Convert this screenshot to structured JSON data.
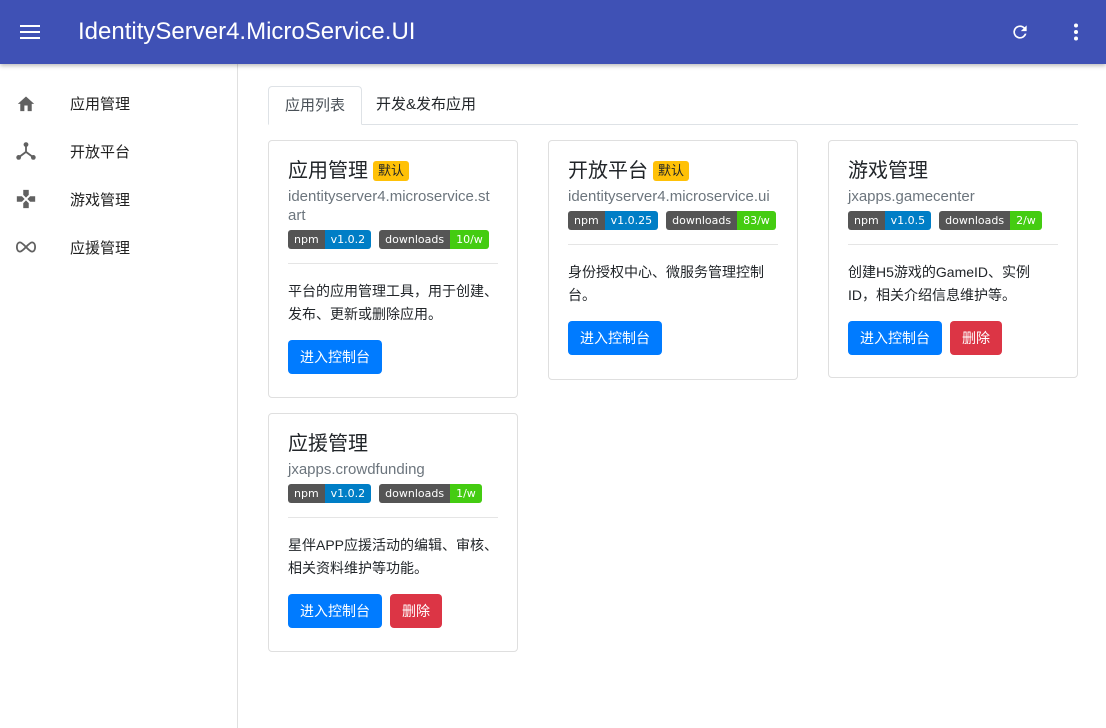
{
  "appbar": {
    "title": "IdentityServer4.MicroService.UI"
  },
  "sidebar": {
    "items": [
      {
        "label": "应用管理",
        "icon": "home-icon"
      },
      {
        "label": "开放平台",
        "icon": "hub-icon"
      },
      {
        "label": "游戏管理",
        "icon": "gamepad-icon"
      },
      {
        "label": "应援管理",
        "icon": "infinity-icon"
      }
    ]
  },
  "tabs": [
    {
      "label": "应用列表",
      "active": true
    },
    {
      "label": "开发&发布应用",
      "active": false
    }
  ],
  "cards": [
    {
      "title": "应用管理",
      "badge": "默认",
      "package": "identityserver4.microservice.start",
      "npm_label": "npm",
      "npm_version": "v1.0.2",
      "downloads_label": "downloads",
      "downloads_value": "10/w",
      "description": "平台的应用管理工具，用于创建、发布、更新或删除应用。",
      "console_button": "进入控制台"
    },
    {
      "title": "开放平台",
      "badge": "默认",
      "package": "identityserver4.microservice.ui",
      "npm_label": "npm",
      "npm_version": "v1.0.25",
      "downloads_label": "downloads",
      "downloads_value": "83/w",
      "description": "身份授权中心、微服务管理控制台。",
      "console_button": "进入控制台"
    },
    {
      "title": "游戏管理",
      "package": "jxapps.gamecenter",
      "npm_label": "npm",
      "npm_version": "v1.0.5",
      "downloads_label": "downloads",
      "downloads_value": "2/w",
      "description": "创建H5游戏的GameID、实例ID，相关介绍信息维护等。",
      "console_button": "进入控制台",
      "delete_button": "删除"
    },
    {
      "title": "应援管理",
      "package": "jxapps.crowdfunding",
      "npm_label": "npm",
      "npm_version": "v1.0.2",
      "downloads_label": "downloads",
      "downloads_value": "1/w",
      "description": "星伴APP应援活动的编辑、审核、相关资料维护等功能。",
      "console_button": "进入控制台",
      "delete_button": "删除"
    }
  ],
  "colors": {
    "appbar": "#3f51b5",
    "primary": "#007bff",
    "danger": "#dc3545",
    "badge": "#ffc107"
  }
}
